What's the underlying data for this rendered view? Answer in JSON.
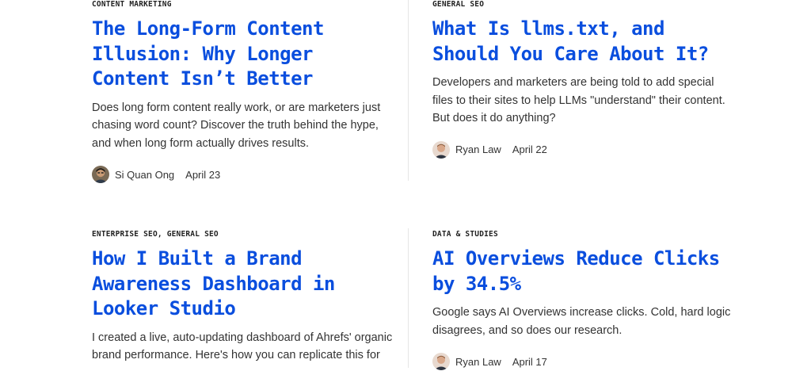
{
  "articles": [
    {
      "category": "CONTENT MARKETING",
      "title": "The Long-Form Content Illusion: Why Longer Content Isn’t Better",
      "excerpt": "Does long form content really work, or are marketers just chasing word count? Discover the truth behind the hype, and when long form actually drives results.",
      "author": "Si Quan Ong",
      "date": "April 23",
      "avatar": "si-quan-ong-avatar"
    },
    {
      "category": "GENERAL SEO",
      "title": "What Is llms.txt, and Should You Care About It?",
      "excerpt": "Developers and marketers are being told to add special files to their sites to help LLMs \"understand\" their content. But does it do anything?",
      "author": "Ryan Law",
      "date": "April 22",
      "avatar": "ryan-law-avatar"
    },
    {
      "category": "ENTERPRISE SEO, GENERAL SEO",
      "title": "How I Built a Brand Awareness Dashboard in Looker Studio",
      "excerpt": "I created a live, auto-updating dashboard of Ahrefs' organic brand performance. Here's how you can replicate this for",
      "author": "",
      "date": "",
      "avatar": ""
    },
    {
      "category": "DATA & STUDIES",
      "title": "AI Overviews Reduce Clicks by 34.5%",
      "excerpt": "Google says AI Overviews increase clicks. Cold, hard logic disagrees, and so does our research.",
      "author": "Ryan Law",
      "date": "April 17",
      "avatar": "ryan-law-avatar"
    }
  ],
  "colors": {
    "title": "#0a4ede",
    "text": "#333333",
    "category": "#222222",
    "divider": "#e6e6e6"
  }
}
